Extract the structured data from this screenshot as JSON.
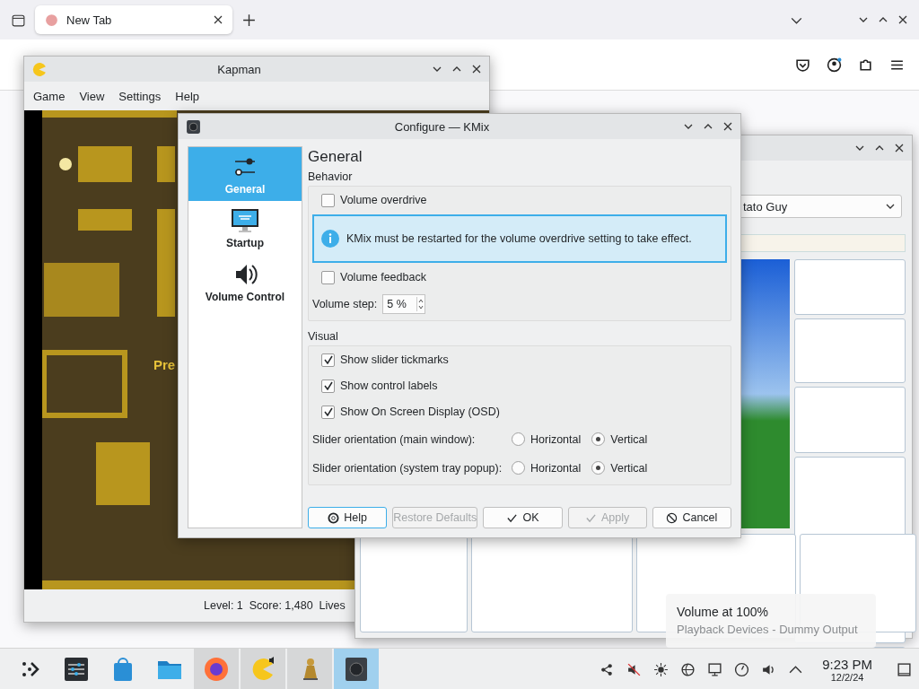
{
  "browser": {
    "tabs": [
      {
        "title": "New Tab",
        "selected": true
      }
    ]
  },
  "kapman": {
    "title": "Kapman",
    "menu": [
      "Game",
      "View",
      "Settings",
      "Help"
    ],
    "game_text": "Pre",
    "status": "Level: 1  Score: 1,480  Lives"
  },
  "potato_window": {
    "dropdown": "tato Guy"
  },
  "dialog": {
    "title": "Configure — KMix",
    "pages": [
      {
        "label": "General",
        "kind": "sliders",
        "selected": true
      },
      {
        "label": "Startup",
        "kind": "monitor",
        "selected": false
      },
      {
        "label": "Volume Control",
        "kind": "speaker",
        "selected": false
      }
    ],
    "heading": "General",
    "sections": [
      {
        "title": "Behavior",
        "items": [
          {
            "kind": "checkbox",
            "label": "Volume overdrive",
            "checked": false
          },
          {
            "kind": "message",
            "text": "KMix must be restarted for the volume overdrive setting to take effect."
          },
          {
            "kind": "checkbox",
            "label": "Volume feedback",
            "checked": false
          },
          {
            "kind": "spin",
            "label": "Volume step:",
            "value": "5 %"
          }
        ]
      },
      {
        "title": "Visual",
        "items": [
          {
            "kind": "checkbox",
            "label": "Show slider tickmarks",
            "checked": true
          },
          {
            "kind": "checkbox",
            "label": "Show control labels",
            "checked": true
          },
          {
            "kind": "checkbox",
            "label": "Show On Screen Display (OSD)",
            "checked": true
          },
          {
            "kind": "radio",
            "label": "Slider orientation (main window):",
            "options": [
              {
                "label": "Horizontal",
                "selected": false
              },
              {
                "label": "Vertical",
                "selected": true
              }
            ]
          },
          {
            "kind": "radio",
            "label": "Slider orientation (system tray popup):",
            "options": [
              {
                "label": "Horizontal",
                "selected": false
              },
              {
                "label": "Vertical",
                "selected": true
              }
            ]
          }
        ]
      }
    ],
    "buttons": [
      {
        "label": "Help",
        "kind": "help",
        "disabled": false
      },
      {
        "label": "Restore Defaults",
        "kind": "restore",
        "disabled": true
      },
      {
        "label": "OK",
        "kind": "ok",
        "disabled": false
      },
      {
        "label": "Apply",
        "kind": "apply",
        "disabled": true
      },
      {
        "label": "Cancel",
        "kind": "cancel",
        "disabled": false
      }
    ]
  },
  "osd": {
    "title": "Volume at 100%",
    "subtitle": "Playback Devices - Dummy Output"
  },
  "taskbar": {
    "apps": [
      {
        "kind": "launcher",
        "running": false,
        "selected": false
      },
      {
        "kind": "settings",
        "running": false,
        "selected": false
      },
      {
        "kind": "store",
        "running": false,
        "selected": false
      },
      {
        "kind": "files",
        "running": false,
        "selected": false
      },
      {
        "kind": "browser",
        "running": true,
        "selected": false
      },
      {
        "kind": "game",
        "running": true,
        "selected": false
      },
      {
        "kind": "toy",
        "running": true,
        "selected": false
      },
      {
        "kind": "mixer",
        "running": true,
        "selected": true
      }
    ],
    "time": "9:23 PM",
    "date": "12/2/24"
  }
}
